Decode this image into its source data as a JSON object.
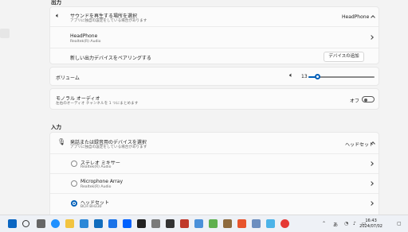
{
  "output_section": {
    "title": "出力",
    "sound_output": {
      "label": "サウンドを再生する場所を選択",
      "sublabel": "アプリに独自の設定をしている場合があります",
      "value": "HeadPhone"
    },
    "device": {
      "name": "HeadPhone",
      "driver": "Realtek(R) Audio"
    },
    "pair": {
      "label": "新しい出力デバイスをペアリングする",
      "button": "デバイスの追加"
    },
    "volume": {
      "label": "ボリューム",
      "value": "13",
      "level": 0.13
    },
    "mono": {
      "label": "モノラル オーディオ",
      "sublabel": "左右のオーディオ チャンネルを 1 つにまとめます",
      "state": "オフ"
    }
  },
  "input_section": {
    "title": "入力",
    "input_select": {
      "label": "発話または録音用のデバイスを選択",
      "sublabel": "アプリに独自の設定をしている場合があります",
      "value": "ヘッドセット"
    },
    "devices": [
      {
        "name": "ステレオ ミキサー",
        "driver": "Realtek(R) Audio",
        "selected": false
      },
      {
        "name": "Microphone Array",
        "driver": "Realtek(R) Audio",
        "selected": false
      },
      {
        "name": "ヘッドセット",
        "driver": "BCH BH330",
        "selected": true
      }
    ]
  },
  "taskbar": {
    "tray_lang": "あ",
    "time": "16:43",
    "date": "2024/07/02"
  },
  "colors": {
    "accent": "#005fb8",
    "background": "#f3f3f3",
    "card": "#fbfbfb"
  }
}
